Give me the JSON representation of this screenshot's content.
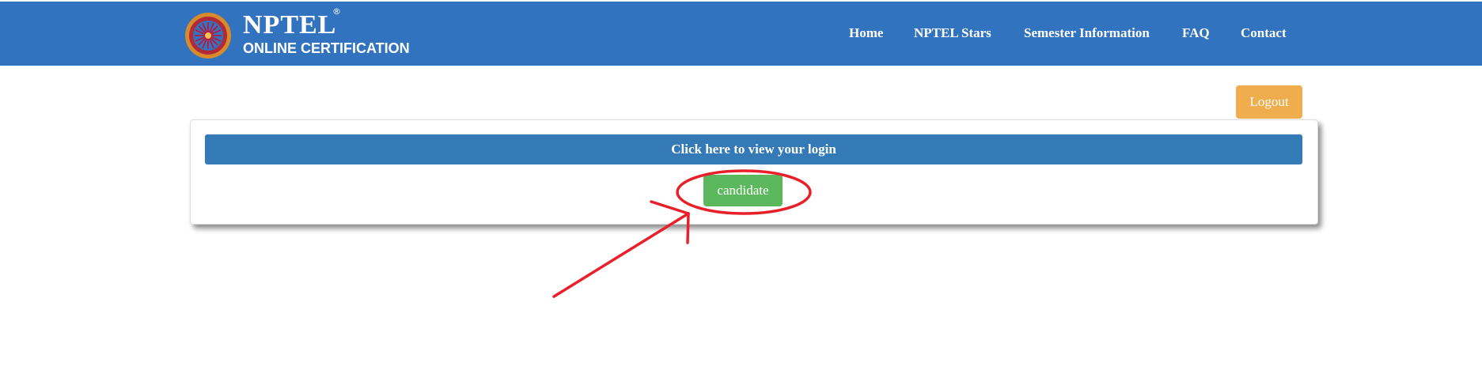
{
  "header": {
    "brand": {
      "title": "NPTEL",
      "registered_mark": "®",
      "subtitle": "ONLINE CERTIFICATION"
    },
    "nav": [
      {
        "label": "Home"
      },
      {
        "label": "NPTEL Stars"
      },
      {
        "label": "Semester Information"
      },
      {
        "label": "FAQ"
      },
      {
        "label": "Contact"
      }
    ],
    "background_color": "#3273c0"
  },
  "actions": {
    "logout_label": "Logout",
    "logout_color": "#f0ad4e"
  },
  "login_panel": {
    "header_label": "Click here to view your login",
    "header_color": "#337ab7",
    "candidate_label": "candidate",
    "candidate_color": "#5cb85c"
  },
  "annotation": {
    "color": "#e8202a",
    "shapes": [
      "ellipse-highlight",
      "arrow"
    ]
  }
}
